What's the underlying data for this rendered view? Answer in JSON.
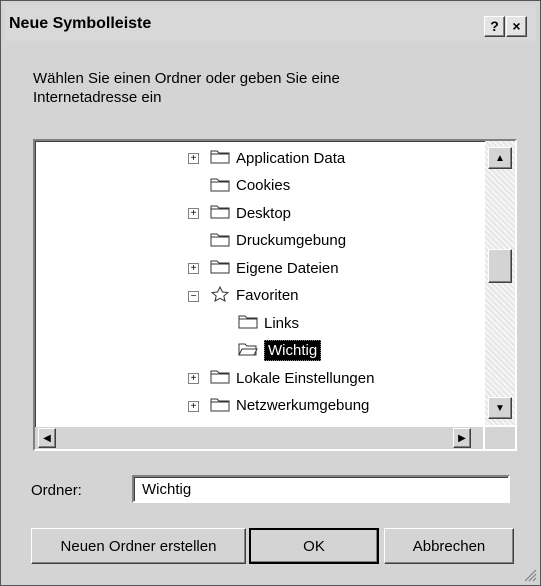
{
  "window": {
    "title": "Neue Symbolleiste",
    "help_glyph": "?",
    "close_glyph": "×"
  },
  "prompt": "Wählen Sie einen Ordner oder geben Sie eine Internetadresse ein",
  "tree": {
    "items": [
      {
        "label": "Application Data",
        "expander": "+",
        "icon": "folder-icon"
      },
      {
        "label": "Cookies",
        "expander": "",
        "icon": "folder-icon"
      },
      {
        "label": "Desktop",
        "expander": "+",
        "icon": "folder-icon"
      },
      {
        "label": "Druckumgebung",
        "expander": "",
        "icon": "folder-icon"
      },
      {
        "label": "Eigene Dateien",
        "expander": "+",
        "icon": "folder-icon"
      },
      {
        "label": "Favoriten",
        "expander": "−",
        "icon": "star-folder-icon"
      },
      {
        "label": "Links",
        "expander": "",
        "icon": "folder-icon"
      },
      {
        "label": "Wichtig",
        "expander": "",
        "icon": "open-folder-icon",
        "selected": true
      },
      {
        "label": "Lokale Einstellungen",
        "expander": "+",
        "icon": "folder-icon"
      },
      {
        "label": "Netzwerkumgebung",
        "expander": "+",
        "icon": "folder-icon"
      }
    ]
  },
  "folder_field": {
    "label": "Ordner:",
    "value": "Wichtig"
  },
  "buttons": {
    "new_folder": "Neuen Ordner erstellen",
    "ok": "OK",
    "cancel": "Abbrechen"
  }
}
